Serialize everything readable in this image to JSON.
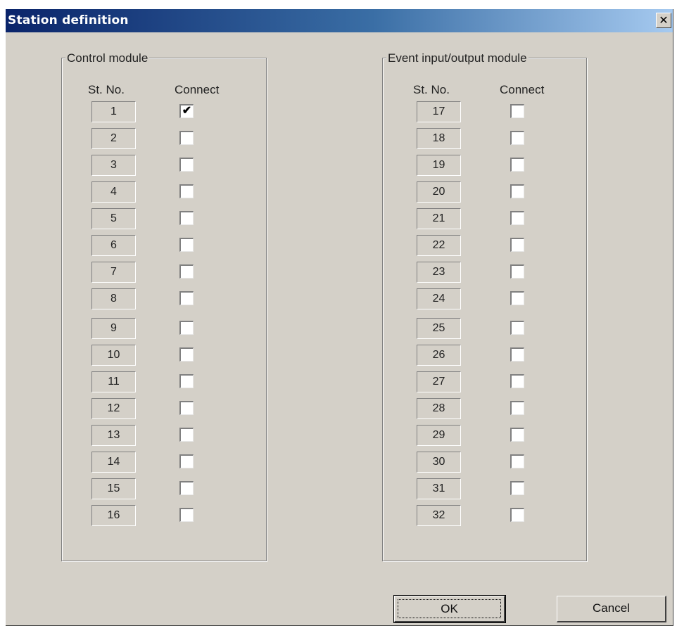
{
  "window": {
    "title": "Station definition",
    "close_icon": "close-icon"
  },
  "control_module": {
    "legend": "Control module",
    "col_stno": "St. No.",
    "col_connect": "Connect",
    "rows": [
      {
        "st": "1",
        "connect": true
      },
      {
        "st": "2",
        "connect": false
      },
      {
        "st": "3",
        "connect": false
      },
      {
        "st": "4",
        "connect": false
      },
      {
        "st": "5",
        "connect": false
      },
      {
        "st": "6",
        "connect": false
      },
      {
        "st": "7",
        "connect": false
      },
      {
        "st": "8",
        "connect": false
      },
      {
        "st": "9",
        "connect": false
      },
      {
        "st": "10",
        "connect": false
      },
      {
        "st": "11",
        "connect": false
      },
      {
        "st": "12",
        "connect": false
      },
      {
        "st": "13",
        "connect": false
      },
      {
        "st": "14",
        "connect": false
      },
      {
        "st": "15",
        "connect": false
      },
      {
        "st": "16",
        "connect": false
      }
    ]
  },
  "event_module": {
    "legend": "Event input/output module",
    "col_stno": "St. No.",
    "col_connect": "Connect",
    "rows": [
      {
        "st": "17",
        "connect": false
      },
      {
        "st": "18",
        "connect": false
      },
      {
        "st": "19",
        "connect": false
      },
      {
        "st": "20",
        "connect": false
      },
      {
        "st": "21",
        "connect": false
      },
      {
        "st": "22",
        "connect": false
      },
      {
        "st": "23",
        "connect": false
      },
      {
        "st": "24",
        "connect": false
      },
      {
        "st": "25",
        "connect": false
      },
      {
        "st": "26",
        "connect": false
      },
      {
        "st": "27",
        "connect": false
      },
      {
        "st": "28",
        "connect": false
      },
      {
        "st": "29",
        "connect": false
      },
      {
        "st": "30",
        "connect": false
      },
      {
        "st": "31",
        "connect": false
      },
      {
        "st": "32",
        "connect": false
      }
    ]
  },
  "buttons": {
    "ok": "OK",
    "cancel": "Cancel"
  }
}
